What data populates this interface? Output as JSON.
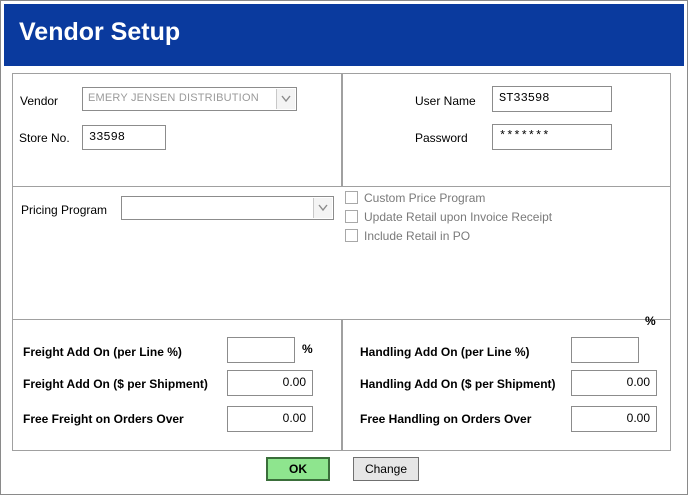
{
  "window": {
    "title": "Vendor Setup"
  },
  "vendor_section": {
    "vendor_label": "Vendor",
    "vendor_value": "EMERY JENSEN DISTRIBUTION",
    "store_label": "Store No.",
    "store_value": "33598"
  },
  "login_section": {
    "username_label": "User Name",
    "username_value": "ST33598",
    "password_label": "Password",
    "password_value": "*******"
  },
  "pricing_section": {
    "pricing_label": "Pricing Program",
    "pricing_value": "",
    "options": [
      {
        "label": "Custom Price Program",
        "checked": false
      },
      {
        "label": "Update Retail upon Invoice Receipt",
        "checked": false
      },
      {
        "label": "Include Retail in PO",
        "checked": false
      }
    ]
  },
  "freight_section": {
    "line_label": "Freight Add On (per Line %)",
    "line_value": "",
    "percent_symbol": "%",
    "shipment_label": "Freight Add On ($ per Shipment)",
    "shipment_value": "0.00",
    "free_label": "Free Freight on Orders Over",
    "free_value": "0.00"
  },
  "handling_section": {
    "percent_symbol": "%",
    "line_label": "Handling Add On (per Line %)",
    "line_value": "",
    "shipment_label": "Handling Add On ($ per Shipment)",
    "shipment_value": "0.00",
    "free_label": "Free Handling on Orders Over",
    "free_value": "0.00"
  },
  "buttons": {
    "ok_label": "OK",
    "change_label": "Change"
  },
  "colors": {
    "title_bar": "#0a3a9e",
    "ok_button": "#8ee58e"
  }
}
